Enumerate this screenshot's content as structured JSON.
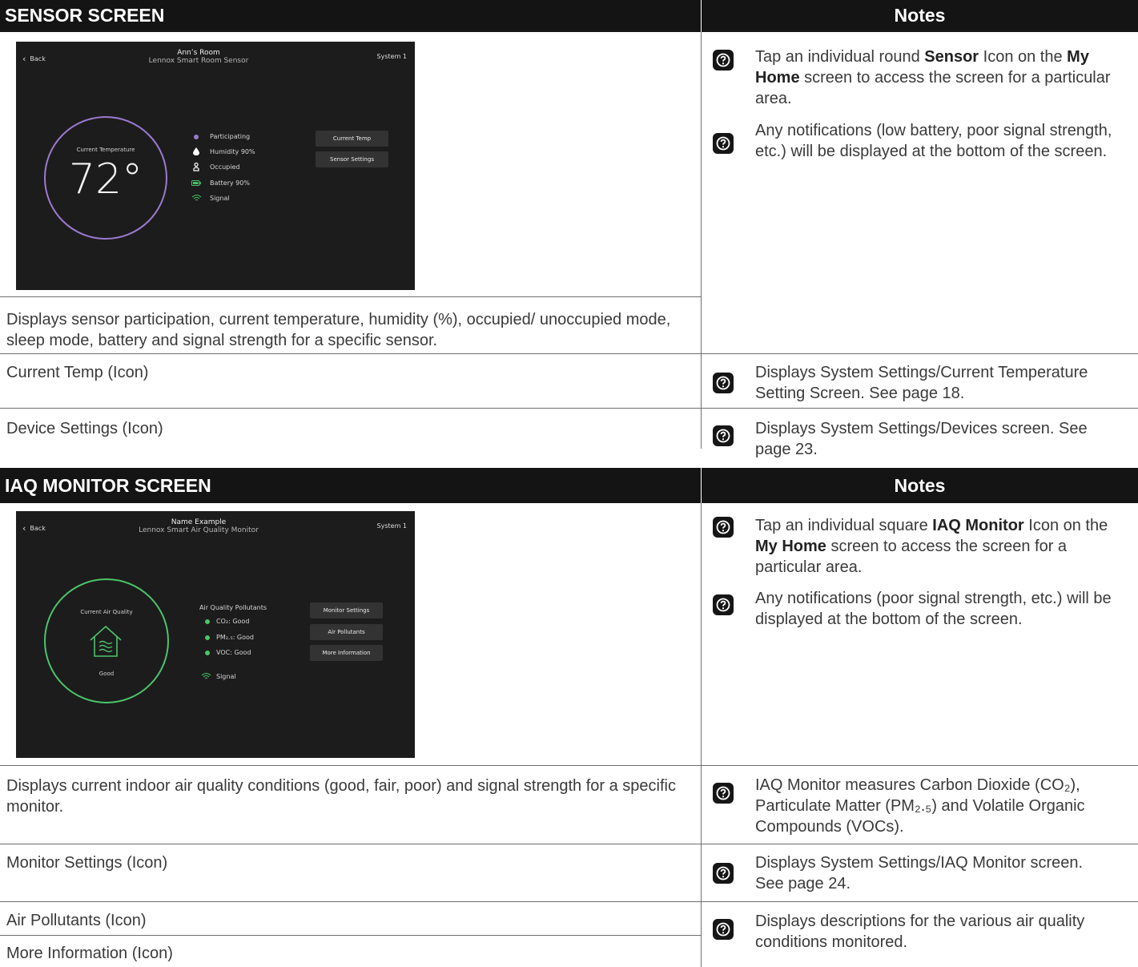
{
  "sensor_section": {
    "header": "SENSOR SCREEN",
    "notes_header": "Notes",
    "screen": {
      "back_label": "Back",
      "title": "Ann’s Room",
      "subtitle": "Lennox Smart Room Sensor",
      "system_label": "System 1",
      "gauge_label": "Current Temperature",
      "temperature": "72°",
      "ring_color": "#9b7ad0",
      "statuses": [
        {
          "icon": "participating-dot-icon",
          "label": "Participating"
        },
        {
          "icon": "humidity-drop-icon",
          "label": "Humidity 90%"
        },
        {
          "icon": "occupied-person-icon",
          "label": "Occupied"
        },
        {
          "icon": "battery-icon",
          "label": "Battery 90%"
        },
        {
          "icon": "signal-icon",
          "label": "Signal"
        }
      ],
      "buttons": [
        "Current Temp",
        "Sensor Settings"
      ]
    },
    "description": "Displays sensor participation, current temperature, humidity (%), occupied/ unoccupied mode, sleep mode, battery and signal strength for a specific sensor.",
    "notes": [
      {
        "pre": "Tap an individual round ",
        "bold1": "Sensor",
        "mid": " Icon on the ",
        "bold2": "My Home",
        "post": " screen to access the screen for a particular area."
      },
      {
        "text": "Any notifications (low battery, poor signal strength, etc.) will be displayed at the bottom of the screen."
      }
    ],
    "rows": [
      {
        "label": "Current Temp (Icon)",
        "note": "Displays System Settings/Current Temperature Setting Screen. See page 18."
      },
      {
        "label": "Device Settings (Icon)",
        "note": "Displays System Settings/Devices screen. See page 23."
      }
    ]
  },
  "iaq_section": {
    "header": "IAQ MONITOR SCREEN",
    "notes_header": "Notes",
    "screen": {
      "back_label": "Back",
      "title": "Name Example",
      "subtitle": "Lennox Smart Air Quality Monitor",
      "system_label": "System 1",
      "gauge_label": "Current Air Quality",
      "gauge_value": "Good",
      "ring_color": "#4cc46a",
      "pollutants_title": "Air Quality Pollutants",
      "pollutants": [
        {
          "name": "CO₂",
          "value": ": Good"
        },
        {
          "name": "PM₂.₅",
          "value": ": Good"
        },
        {
          "name": "VOC",
          "value": ": Good"
        }
      ],
      "signal_label": "Signal",
      "buttons": [
        "Monitor Settings",
        "Air Pollutants",
        "More Information"
      ]
    },
    "notes": [
      {
        "pre": "Tap an individual square ",
        "bold1": "IAQ Monitor",
        "mid": " Icon on the ",
        "bold2": "My Home",
        "post": " screen to access the screen for a particular area."
      },
      {
        "text": "Any notifications (poor signal strength, etc.) will be displayed at the bottom of the screen."
      }
    ],
    "description": "Displays current indoor air quality conditions (good, fair, poor) and signal strength for a specific monitor.",
    "description_note": "IAQ Monitor measures Carbon Dioxide (CO₂), Particulate Matter (PM₂.₅) and Volatile Organic Compounds (VOCs).",
    "rows": [
      {
        "label": "Monitor Settings (Icon)",
        "note": "Displays System Settings/IAQ Monitor screen. See page 24."
      },
      {
        "label": "Air Pollutants (Icon)",
        "note": "Displays descriptions for the various air quality conditions monitored."
      },
      {
        "label": "More Information (Icon)"
      }
    ]
  }
}
